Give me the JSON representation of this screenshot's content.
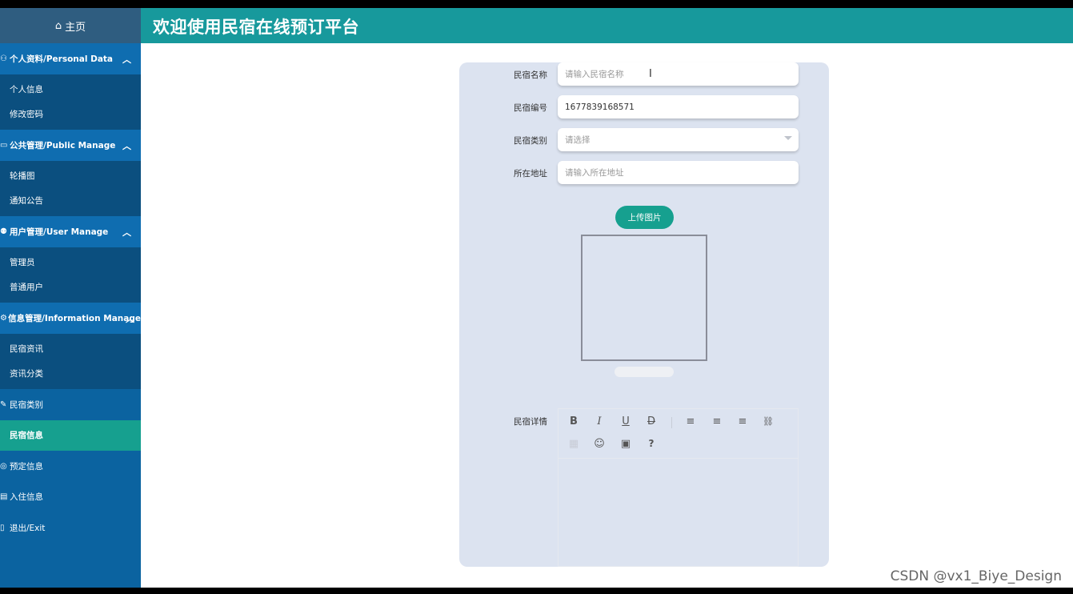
{
  "sidebar": {
    "home": {
      "icon": "home-icon",
      "label": "主页"
    },
    "groups": [
      {
        "label": "个人资料/Personal Data",
        "icon": "person-icon",
        "items": [
          "个人信息",
          "修改密码"
        ]
      },
      {
        "label": "公共管理/Public Manage",
        "icon": "monitor-icon",
        "items": [
          "轮播图",
          "通知公告"
        ]
      },
      {
        "label": "用户管理/User Manage",
        "icon": "user-gear-icon",
        "items": [
          "管理员",
          "普通用户"
        ]
      },
      {
        "label": "信息管理/Information Manage",
        "icon": "gear-icon",
        "items": [
          "民宿资讯",
          "资讯分类"
        ]
      }
    ],
    "menu": [
      {
        "label": "民宿类别",
        "icon": "link-icon"
      },
      {
        "label": "民宿信息",
        "icon": "",
        "active": true
      },
      {
        "label": "预定信息",
        "icon": "settings-icon"
      },
      {
        "label": "入住信息",
        "icon": "clipboard-icon"
      },
      {
        "label": "退出/Exit",
        "icon": "exit-icon"
      }
    ]
  },
  "header": {
    "title": "欢迎使用民宿在线预订平台"
  },
  "form": {
    "name": {
      "label": "民宿名称",
      "placeholder": "请输入民宿名称"
    },
    "code": {
      "label": "民宿编号",
      "value": "1677839168571"
    },
    "category": {
      "label": "民宿类别",
      "placeholder": "请选择"
    },
    "address": {
      "label": "所在地址",
      "placeholder": "请输入所在地址"
    },
    "upload_label": "上传图片",
    "detail_label": "民宿详情"
  },
  "editor": {
    "tools": [
      "B",
      "I",
      "U",
      "D",
      "≡",
      "≡",
      "≡",
      "🔗",
      "▦",
      "☺",
      "▣",
      "?"
    ]
  },
  "watermark": "CSDN @vx1_Biye_Design"
}
